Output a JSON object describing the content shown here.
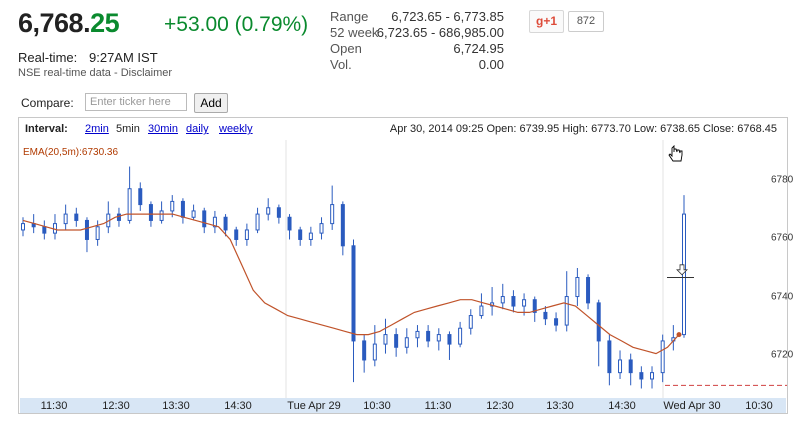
{
  "quote": {
    "price_int": "6,768.",
    "price_dec": "25",
    "change": "+53.00 (0.79%)",
    "realtime_label": "Real-time:",
    "realtime_time": "9:27AM IST",
    "nse_note": "NSE real-time data - Disclaimer"
  },
  "stats": [
    {
      "label": "Range",
      "value": "6,723.65 - 6,773.85"
    },
    {
      "label": "52 week",
      "value": "6,723.65 - 686,985.00"
    },
    {
      "label": "Open",
      "value": "6,724.95"
    },
    {
      "label": "Vol.",
      "value": "0.00"
    }
  ],
  "social": {
    "gplus_label": "g+1",
    "count": "872"
  },
  "compare": {
    "label": "Compare:",
    "placeholder": "Enter ticker here",
    "button": "Add"
  },
  "chart_header": {
    "interval_label": "Interval:",
    "intervals": [
      {
        "label": "2min",
        "current": false
      },
      {
        "label": "5min",
        "current": true
      },
      {
        "label": "30min",
        "current": false
      },
      {
        "label": "daily",
        "current": false
      },
      {
        "label": "weekly",
        "current": false
      }
    ],
    "ohlc": "Apr 30, 2014 09:25 Open: 6739.95 High: 6773.70 Low: 6738.65 Close: 6768.45"
  },
  "ema_label": "EMA(20,5m):6730.36",
  "colors": {
    "up": "#0a8a2e",
    "candle": "#2a5bbf",
    "ema": "#c0532a",
    "axis_band": "#d8e6f5",
    "ref_line": "#d04040"
  },
  "chart_data": {
    "type": "candlestick",
    "y_ticks": [
      6720,
      6740,
      6760,
      6780
    ],
    "ylim": [
      6710,
      6792
    ],
    "x_ticks": [
      "11:30",
      "12:30",
      "13:30",
      "14:30",
      "Tue Apr 29",
      "10:30",
      "11:30",
      "12:30",
      "13:30",
      "14:30",
      "Wed Apr 30",
      "10:30"
    ],
    "ema_series": [
      6766,
      6765,
      6764,
      6763,
      6763,
      6763,
      6764,
      6765,
      6767,
      6768,
      6768,
      6768,
      6768,
      6768,
      6767,
      6766,
      6765,
      6764,
      6760,
      6752,
      6744,
      6740,
      6738,
      6736,
      6735,
      6734,
      6733,
      6732,
      6731,
      6730,
      6730,
      6731,
      6733,
      6735,
      6737,
      6738,
      6739,
      6740,
      6741,
      6741,
      6740,
      6739,
      6738,
      6737,
      6737,
      6738,
      6739,
      6740,
      6739,
      6736,
      6733,
      6730,
      6728,
      6726,
      6725,
      6724,
      6726,
      6730
    ],
    "candles": [
      [
        6763,
        6765,
        6767,
        6761
      ],
      [
        6765,
        6764,
        6768,
        6762
      ],
      [
        6764,
        6762,
        6766,
        6760
      ],
      [
        6762,
        6765,
        6768,
        6760
      ],
      [
        6765,
        6768,
        6771,
        6763
      ],
      [
        6768,
        6766,
        6770,
        6764
      ],
      [
        6766,
        6760,
        6767,
        6756
      ],
      [
        6760,
        6764,
        6766,
        6758
      ],
      [
        6764,
        6768,
        6772,
        6762
      ],
      [
        6768,
        6766,
        6770,
        6764
      ],
      [
        6766,
        6776,
        6783,
        6765
      ],
      [
        6776,
        6771,
        6778,
        6769
      ],
      [
        6771,
        6766,
        6772,
        6764
      ],
      [
        6766,
        6769,
        6772,
        6765
      ],
      [
        6769,
        6772,
        6774,
        6767
      ],
      [
        6772,
        6767,
        6773,
        6765
      ],
      [
        6767,
        6769,
        6771,
        6766
      ],
      [
        6769,
        6764,
        6770,
        6762
      ],
      [
        6764,
        6767,
        6769,
        6762
      ],
      [
        6767,
        6763,
        6768,
        6761
      ],
      [
        6763,
        6760,
        6764,
        6758
      ],
      [
        6760,
        6763,
        6765,
        6758
      ],
      [
        6763,
        6768,
        6770,
        6762
      ],
      [
        6768,
        6770,
        6773,
        6766
      ],
      [
        6770,
        6767,
        6771,
        6765
      ],
      [
        6767,
        6763,
        6768,
        6760
      ],
      [
        6763,
        6760,
        6764,
        6758
      ],
      [
        6760,
        6762,
        6764,
        6758
      ],
      [
        6762,
        6765,
        6767,
        6760
      ],
      [
        6765,
        6771,
        6777,
        6763
      ],
      [
        6771,
        6758,
        6772,
        6755
      ],
      [
        6758,
        6728,
        6760,
        6715
      ],
      [
        6728,
        6722,
        6730,
        6718
      ],
      [
        6722,
        6727,
        6733,
        6720
      ],
      [
        6727,
        6730,
        6735,
        6724
      ],
      [
        6730,
        6726,
        6732,
        6723
      ],
      [
        6726,
        6729,
        6732,
        6724
      ],
      [
        6729,
        6731,
        6733,
        6726
      ],
      [
        6731,
        6728,
        6733,
        6726
      ],
      [
        6728,
        6730,
        6732,
        6725
      ],
      [
        6730,
        6727,
        6731,
        6722
      ],
      [
        6727,
        6732,
        6734,
        6726
      ],
      [
        6732,
        6736,
        6738,
        6730
      ],
      [
        6736,
        6739,
        6743,
        6735
      ],
      [
        6739,
        6740,
        6745,
        6736
      ],
      [
        6740,
        6742,
        6746,
        6738
      ],
      [
        6742,
        6739,
        6744,
        6737
      ],
      [
        6739,
        6741,
        6743,
        6736
      ],
      [
        6741,
        6737,
        6742,
        6734
      ],
      [
        6737,
        6735,
        6739,
        6733
      ],
      [
        6735,
        6733,
        6737,
        6731
      ],
      [
        6733,
        6742,
        6750,
        6731
      ],
      [
        6742,
        6748,
        6751,
        6739
      ],
      [
        6748,
        6740,
        6749,
        6738
      ],
      [
        6740,
        6728,
        6741,
        6720
      ],
      [
        6728,
        6718,
        6730,
        6714
      ],
      [
        6718,
        6722,
        6725,
        6716
      ],
      [
        6722,
        6718,
        6724,
        6714
      ],
      [
        6718,
        6716,
        6720,
        6713
      ],
      [
        6716,
        6718,
        6720,
        6713
      ],
      [
        6718,
        6728,
        6730,
        6715
      ],
      [
        6728,
        6729,
        6733,
        6725
      ],
      [
        6730,
        6768,
        6774,
        6729
      ]
    ]
  }
}
